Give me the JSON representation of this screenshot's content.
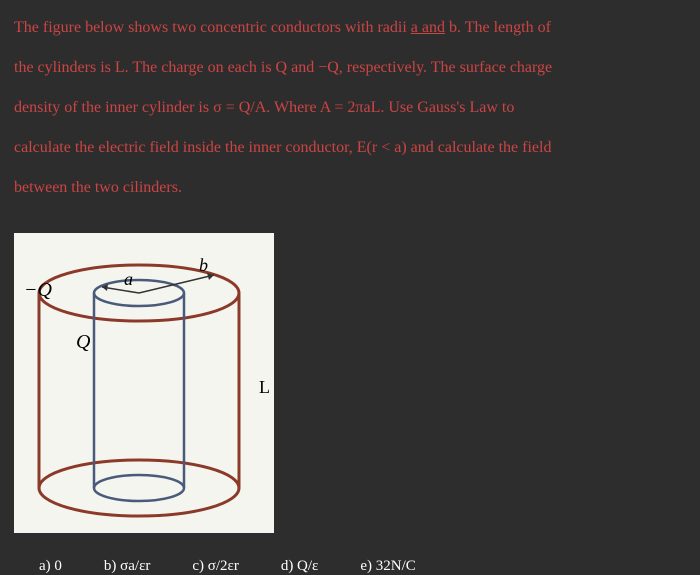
{
  "problem": {
    "line1_pre": "The figure below shows two concentric conductors with radii ",
    "line1_underlined": "a and",
    "line1_post": " b. The length of",
    "line2": "the cylinders is L. The charge on each is Q and −Q, respectively. The surface charge",
    "line3": "density of the inner cylinder is σ = Q/A. Where A = 2πaL. Use Gauss's Law to",
    "line4": "calculate the electric field inside the inner conductor, E(r < a) and calculate the field",
    "line5": "between the two cilinders."
  },
  "figure": {
    "label_minusQ": "−Q",
    "label_Q": "Q",
    "label_a": "a",
    "label_b": "b",
    "label_L": "L"
  },
  "answers": {
    "a": "a)   0",
    "b": "b) σa/εr",
    "c": "c) σ/2εr",
    "d": "d) Q/ε",
    "e": "e) 32N/C"
  }
}
